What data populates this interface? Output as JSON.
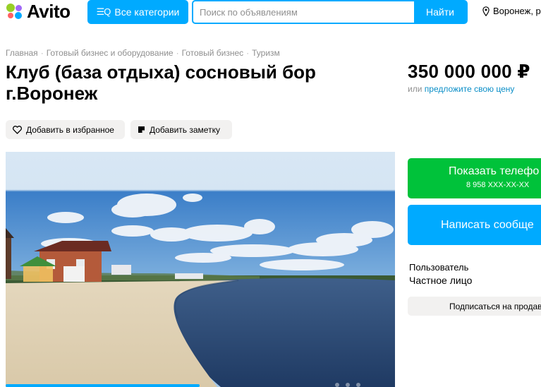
{
  "header": {
    "logo_text": "Avito",
    "categories_label": "Все категории",
    "search_placeholder": "Поиск по объявлениям",
    "search_button": "Найти",
    "location": "Воронеж, ра"
  },
  "breadcrumbs": [
    "Главная",
    "Готовый бизнес и оборудование",
    "Готовый бизнес",
    "Туризм"
  ],
  "listing": {
    "title_line1": "Клуб (база отдыха) сосновый бор",
    "title_line2": "г.Воронеж",
    "price": "350 000 000 ₽",
    "offer_prefix": "или",
    "offer_link": "предложите свою цену",
    "favorite_label": "Добавить в избранное",
    "note_label": "Добавить заметку"
  },
  "contact": {
    "show_phone": "Показать телефо",
    "phone_masked": "8 958 XXX-XX-XX",
    "write_message": "Написать сообще",
    "seller_role": "Пользователь",
    "seller_name": "Частное лицо",
    "subscribe": "Подписаться на продав"
  },
  "colors": {
    "brand_blue": "#00aaff",
    "green": "#00c23a",
    "link": "#0a8ec7"
  }
}
